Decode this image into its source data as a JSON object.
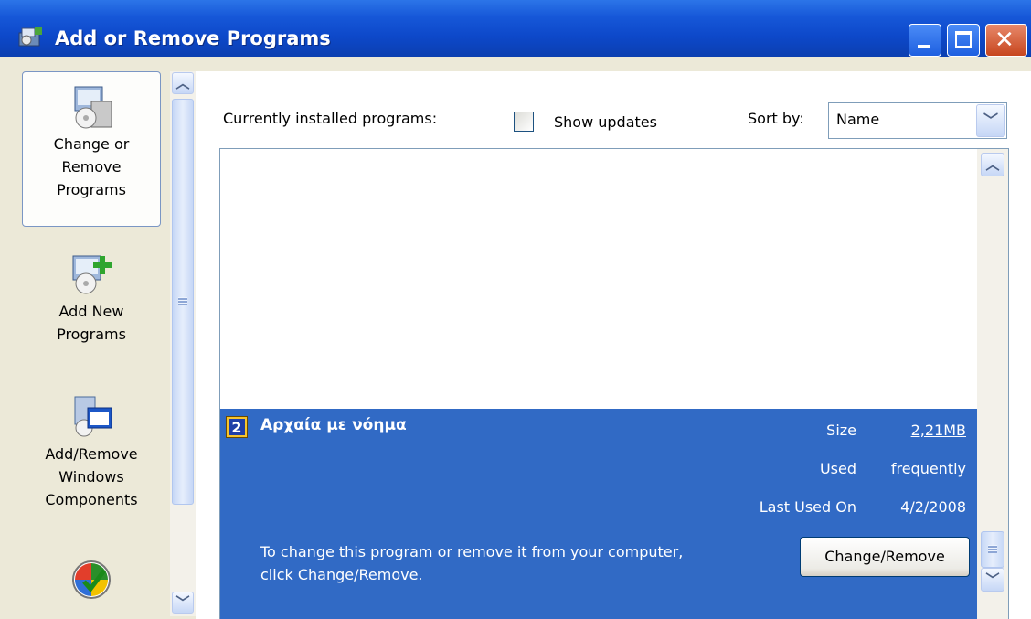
{
  "window": {
    "title": "Add or Remove Programs",
    "buttons": {
      "minimize_icon": "minimize-icon",
      "maximize_icon": "maximize-icon",
      "close_icon": "close-icon"
    }
  },
  "sidebar": {
    "items": [
      {
        "label": "Change or\nRemove\nPrograms",
        "icon": "change-remove-programs-icon",
        "selected": true
      },
      {
        "label": "Add New\nPrograms",
        "icon": "add-new-programs-icon",
        "selected": false
      },
      {
        "label": "Add/Remove\nWindows\nComponents",
        "icon": "windows-components-icon",
        "selected": false
      },
      {
        "label": "",
        "icon": "set-program-access-icon",
        "selected": false
      }
    ]
  },
  "main": {
    "installed_label": "Currently installed programs:",
    "show_updates_label": "Show updates",
    "show_updates_checked": false,
    "sort_label": "Sort by:",
    "sort_value": "Name"
  },
  "program": {
    "name": "Αρχαία με νόημα",
    "size_label": "Size",
    "size_value": "2,21MB",
    "used_label": "Used",
    "used_value": "frequently",
    "last_used_label": "Last Used On",
    "last_used_value": "4/2/2008",
    "hint": "To change this program or remove it from your computer,\nclick Change/Remove.",
    "change_button": "Change/Remove"
  },
  "colors": {
    "titlebar": "#0D48C9",
    "selection": "#316AC5",
    "pane": "#ECE9D8"
  }
}
